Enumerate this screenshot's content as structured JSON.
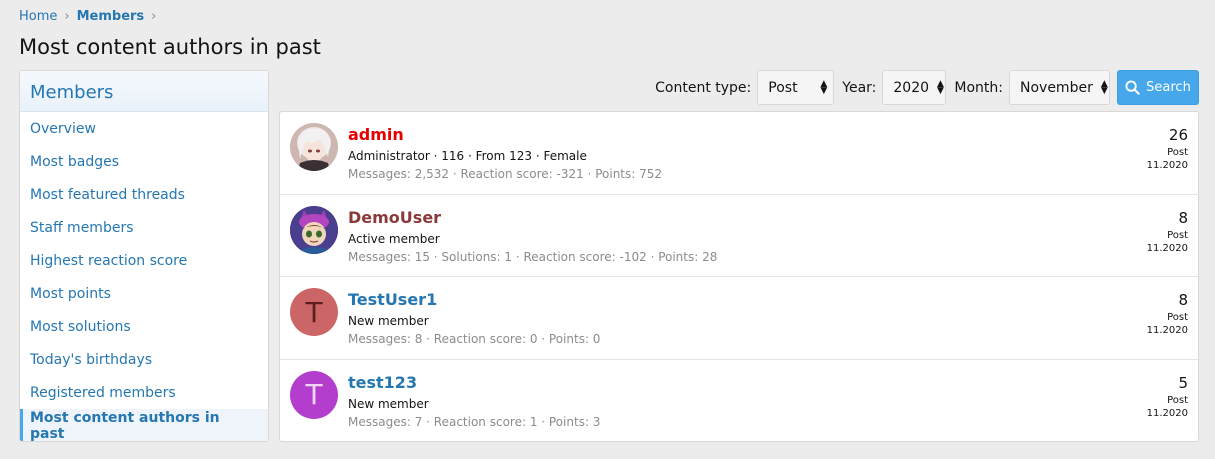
{
  "breadcrumb": {
    "home": "Home",
    "members": "Members",
    "separator": "›"
  },
  "page_title": "Most content authors in past",
  "sidebar": {
    "header": "Members",
    "items": [
      {
        "label": "Overview"
      },
      {
        "label": "Most badges"
      },
      {
        "label": "Most featured threads"
      },
      {
        "label": "Staff members"
      },
      {
        "label": "Highest reaction score"
      },
      {
        "label": "Most points"
      },
      {
        "label": "Most solutions"
      },
      {
        "label": "Today's birthdays"
      },
      {
        "label": "Registered members"
      },
      {
        "label": "Most content authors in past",
        "active": true
      }
    ]
  },
  "filters": {
    "content_type_label": "Content type:",
    "content_type_value": "Post",
    "year_label": "Year:",
    "year_value": "2020",
    "month_label": "Month:",
    "month_value": "November",
    "search_label": "Search"
  },
  "members": [
    {
      "username": "admin",
      "username_color": "#e60000",
      "title": "Administrator · 116 · From 123 · Female",
      "stats": "Messages: 2,532 · Reaction score: -321 · Points: 752",
      "count": "26",
      "type": "Post",
      "date": "11.2020",
      "avatar_type": "image-anime-white-hair"
    },
    {
      "username": "DemoUser",
      "username_color": "#8a3a3a",
      "title": "Active member",
      "stats": "Messages: 15 · Solutions: 1 · Reaction score: -102 · Points: 28",
      "count": "8",
      "type": "Post",
      "date": "11.2020",
      "avatar_type": "image-cartoon-cat-hat"
    },
    {
      "username": "TestUser1",
      "username_color": "#2577b1",
      "title": "New member",
      "stats": "Messages: 8 · Reaction score: 0 · Points: 0",
      "count": "8",
      "type": "Post",
      "date": "11.2020",
      "avatar_letter": "T",
      "avatar_bg": "#cc6666",
      "avatar_fg": "#5c1f1f"
    },
    {
      "username": "test123",
      "username_color": "#2577b1",
      "title": "New member",
      "stats": "Messages: 7 · Reaction score: 1 · Points: 3",
      "count": "5",
      "type": "Post",
      "date": "11.2020",
      "avatar_letter": "T",
      "avatar_bg": "#b33dcc",
      "avatar_fg": "#f0d6f5"
    }
  ]
}
